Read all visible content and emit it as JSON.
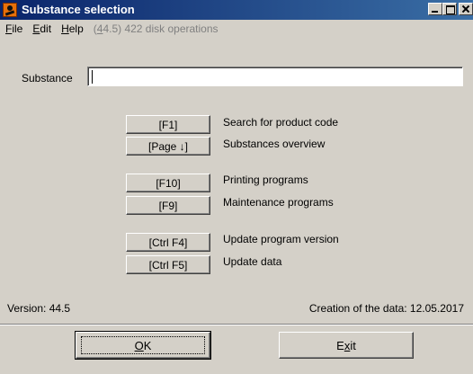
{
  "window": {
    "title": "Substance selection"
  },
  "menu": {
    "file_pre": "",
    "file_ul": "F",
    "file_post": "ile",
    "edit_pre": "",
    "edit_ul": "E",
    "edit_post": "dit",
    "help_pre": "",
    "help_ul": "H",
    "help_post": "elp",
    "status_pre": "(",
    "status_ul": "4",
    "status_post": "4.5) 422 disk operations"
  },
  "substance": {
    "label": "Substance",
    "value": ""
  },
  "functions": [
    {
      "key": "[F1]",
      "label": "Search for product code"
    },
    {
      "key": "[Page ↓]",
      "label": "Substances overview"
    },
    {
      "key": "[F10]",
      "label": "Printing programs"
    },
    {
      "key": "[F9]",
      "label": "Maintenance programs"
    },
    {
      "key": "[Ctrl F4]",
      "label": "Update program version"
    },
    {
      "key": "[Ctrl F5]",
      "label": "Update data"
    }
  ],
  "footer": {
    "version": "Version:  44.5",
    "creation": "Creation of the data:  12.05.2017"
  },
  "buttons": {
    "ok_ul": "O",
    "ok_post": "K",
    "exit_pre": "E",
    "exit_ul": "x",
    "exit_post": "it"
  }
}
